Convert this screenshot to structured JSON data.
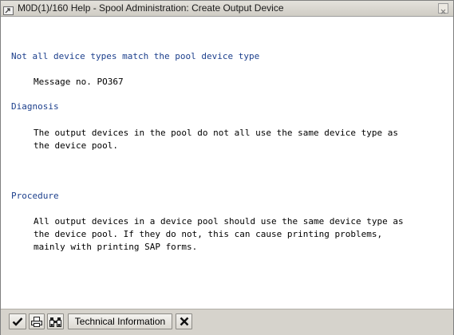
{
  "window": {
    "title": "M0D(1)/160 Help - Spool Administration: Create Output Device"
  },
  "content": {
    "heading_main": "Not all device types match the pool device type",
    "message_no": "Message no. PO367",
    "diagnosis_heading": "Diagnosis",
    "diagnosis_line1": "The output devices in the pool do not all use the same device type as",
    "diagnosis_line2": "the device pool.",
    "procedure_heading": "Procedure",
    "procedure_line1": "All output devices in a device pool should use the same device type as",
    "procedure_line2": "the device pool. If they do not, this can cause printing problems,",
    "procedure_line3": "mainly with printing SAP forms."
  },
  "toolbar": {
    "technical_info_label": "Technical Information"
  },
  "icons": {
    "window_icon": "window-arrow-icon",
    "close": "close-icon",
    "confirm": "checkmark-icon",
    "print": "printer-icon",
    "find": "binoculars-icon",
    "cancel": "cancel-x-icon"
  }
}
